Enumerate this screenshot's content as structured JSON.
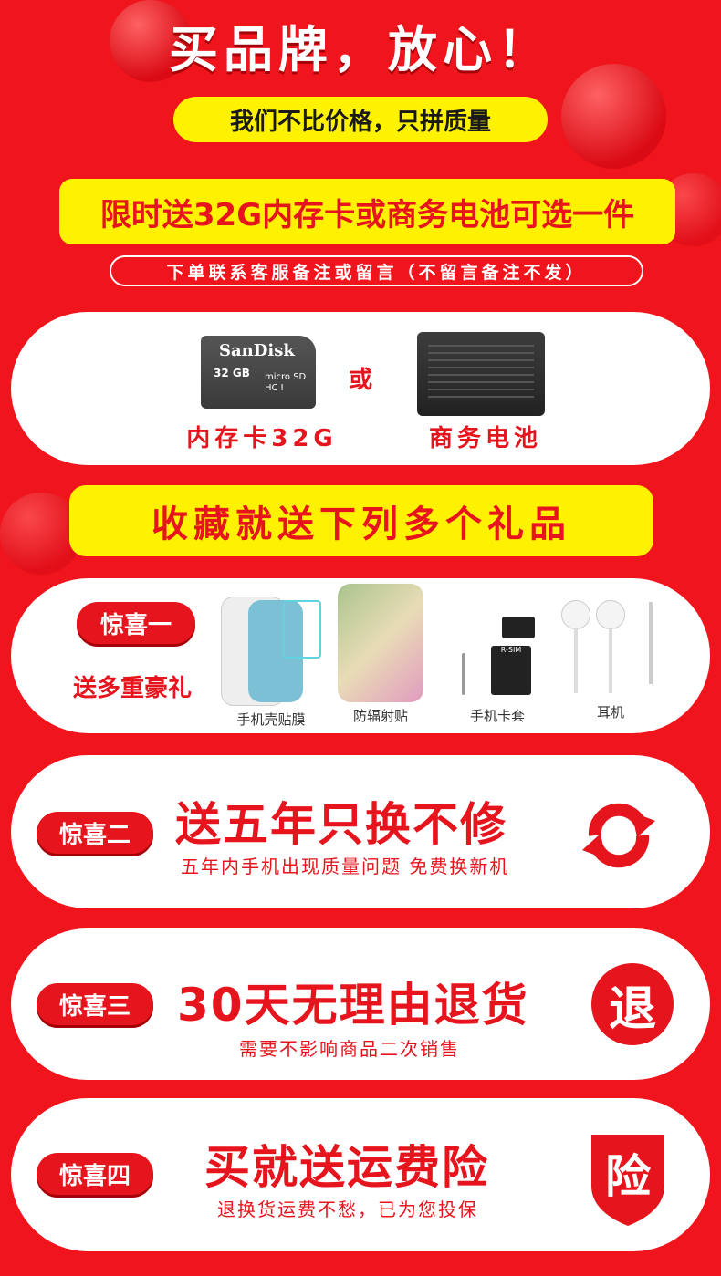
{
  "header": {
    "headline": "买品牌，放心！",
    "subline": "我们不比价格，只拼质量"
  },
  "promo": {
    "banner": "限时送32G内存卡或商务电池可选一件",
    "note": "下单联系客服备注或留言（不留言备注不发）",
    "option1": {
      "brand": "SanDisk",
      "capacity": "32 GB",
      "format": "micro SD HC I",
      "label": "内存卡32G"
    },
    "or": "或",
    "option2": {
      "label": "商务电池"
    }
  },
  "collect_banner": "收藏就送下列多个礼品",
  "surprise1": {
    "badge": "惊喜一",
    "tagline": "送多重豪礼",
    "gifts": [
      "手机壳贴膜",
      "防辐射贴",
      "手机卡套",
      "耳机"
    ],
    "sim_labels": [
      "R-SIM",
      "R-SIM"
    ]
  },
  "surprise2": {
    "badge": "惊喜二",
    "title": "送五年只换不修",
    "subtitle": "五年内手机出现质量问题 免费换新机"
  },
  "surprise3": {
    "badge": "惊喜三",
    "title": "30天无理由退货",
    "subtitle": "需要不影响商品二次销售",
    "icon_char": "退"
  },
  "surprise4": {
    "badge": "惊喜四",
    "title": "买就送运费险",
    "subtitle": "退换货运费不愁，已为您投保",
    "icon_char": "险"
  },
  "colors": {
    "background": "#f0141d",
    "accent_red": "#e6141c",
    "yellow": "#fff200",
    "card": "#ffffff"
  }
}
